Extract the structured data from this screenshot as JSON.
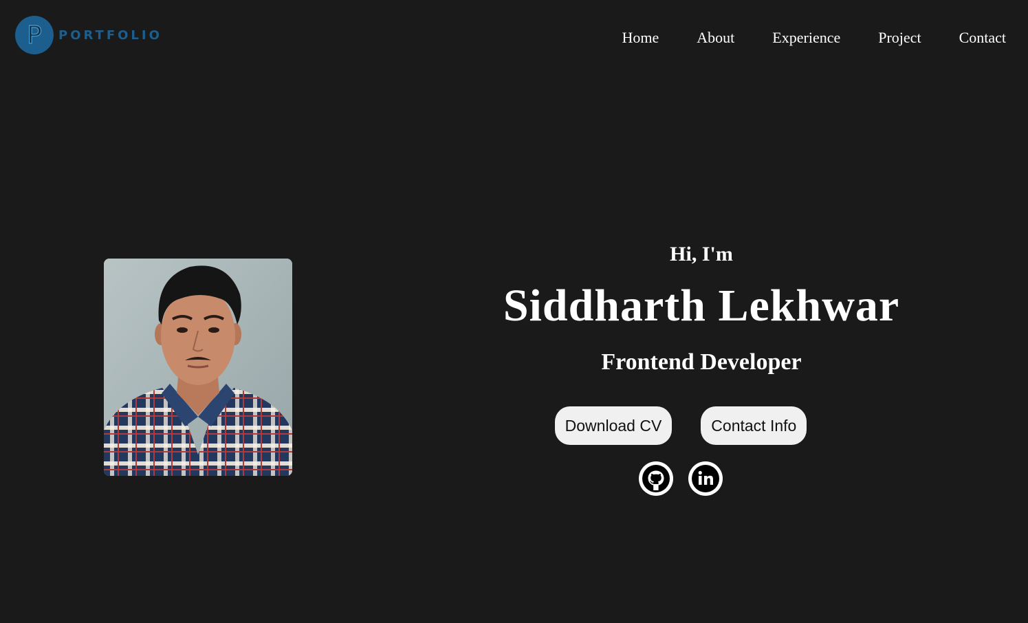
{
  "header": {
    "logo_text": "PORTFOLIO",
    "logo_letter": "P",
    "nav": [
      {
        "label": "Home"
      },
      {
        "label": "About"
      },
      {
        "label": "Experience"
      },
      {
        "label": "Project"
      },
      {
        "label": "Contact"
      }
    ]
  },
  "hero": {
    "greeting": "Hi, I'm",
    "name": "Siddharth Lekhwar",
    "role": "Frontend Developer",
    "buttons": {
      "download_cv": "Download CV",
      "contact_info": "Contact Info"
    },
    "socials": [
      {
        "icon": "github-icon"
      },
      {
        "icon": "linkedin-icon"
      }
    ]
  },
  "colors": {
    "background": "#1a1a1a",
    "brand": "#1c5f8e",
    "text": "#ffffff",
    "button_bg": "#f0f0f0"
  }
}
